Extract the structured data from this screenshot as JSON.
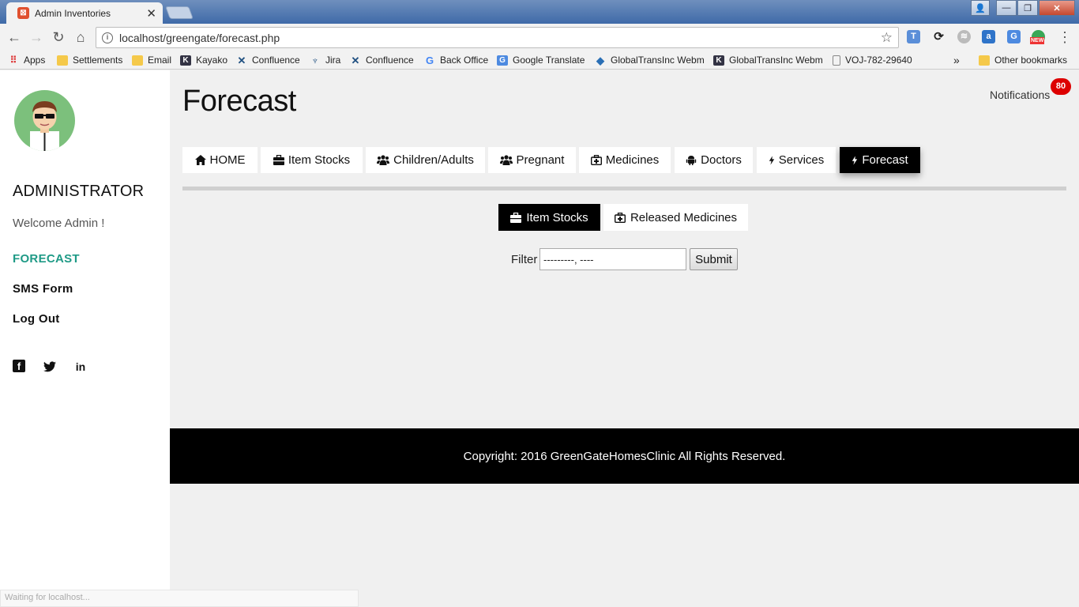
{
  "browser": {
    "tab_title": "Admin Inventories",
    "url": "localhost/greengate/forecast.php",
    "status": "Waiting for localhost...",
    "new_badge": "NEW",
    "bookmarks": [
      {
        "label": "Apps",
        "icon": "apps-grid-icon"
      },
      {
        "label": "Settlements",
        "icon": "folder-icon"
      },
      {
        "label": "Email",
        "icon": "folder-icon"
      },
      {
        "label": "Kayako",
        "icon": "kayako-icon"
      },
      {
        "label": "Confluence",
        "icon": "confluence-icon"
      },
      {
        "label": "Jira",
        "icon": "jira-icon"
      },
      {
        "label": "Confluence",
        "icon": "confluence-icon"
      },
      {
        "label": "Back Office",
        "icon": "google-icon"
      },
      {
        "label": "Google Translate",
        "icon": "google-translate-icon"
      },
      {
        "label": "GlobalTransInc Webm",
        "icon": "globe-icon"
      },
      {
        "label": "GlobalTransInc Webm",
        "icon": "kayako-icon"
      },
      {
        "label": "VOJ-782-29640",
        "icon": "page-icon"
      }
    ],
    "more_bookmarks": "»",
    "other_bookmarks": "Other bookmarks"
  },
  "sidebar": {
    "role": "ADMINISTRATOR",
    "welcome": "Welcome Admin !",
    "links": {
      "forecast": "FORECAST",
      "sms_form": "SMS Form",
      "log_out": "Log Out"
    },
    "social": {
      "facebook": "f",
      "twitter": "t",
      "linkedin": "in"
    }
  },
  "main": {
    "title": "Forecast",
    "notifications_label": "Notifications",
    "notifications_count": "80",
    "nav_tabs": [
      {
        "label": "HOME",
        "icon": "home-icon"
      },
      {
        "label": "Item Stocks",
        "icon": "briefcase-icon"
      },
      {
        "label": "Children/Adults",
        "icon": "users-icon"
      },
      {
        "label": "Pregnant",
        "icon": "users-icon"
      },
      {
        "label": "Medicines",
        "icon": "medkit-icon"
      },
      {
        "label": "Doctors",
        "icon": "android-icon"
      },
      {
        "label": "Services",
        "icon": "bolt-icon"
      },
      {
        "label": "Forecast",
        "icon": "bolt-icon",
        "active": true
      }
    ],
    "sub_tabs": [
      {
        "label": "Item Stocks",
        "icon": "briefcase-icon",
        "active": true
      },
      {
        "label": "Released Medicines",
        "icon": "medkit-icon"
      }
    ],
    "filter": {
      "label": "Filter",
      "value": "---------, ----",
      "submit": "Submit"
    },
    "footer": "Copyright: 2016 GreenGateHomesClinic All Rights Reserved."
  },
  "colors": {
    "accent": "#1f9a86",
    "badge": "#dd0000",
    "active_tab": "#000000"
  }
}
